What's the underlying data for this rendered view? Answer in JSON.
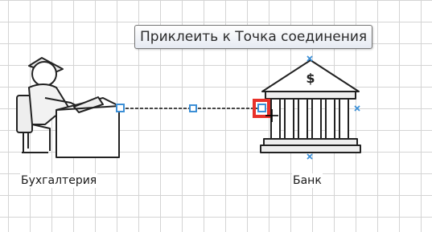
{
  "shapes": {
    "accounting": {
      "label": "Бухгалтерия"
    },
    "bank": {
      "label": "Банк",
      "symbol": "$"
    }
  },
  "tooltip": {
    "text": "Приклеить к Точка соединения"
  },
  "colors": {
    "handle": "#3c8fd6",
    "glue_highlight": "#e8312a",
    "grid": "#d4d4d4"
  }
}
